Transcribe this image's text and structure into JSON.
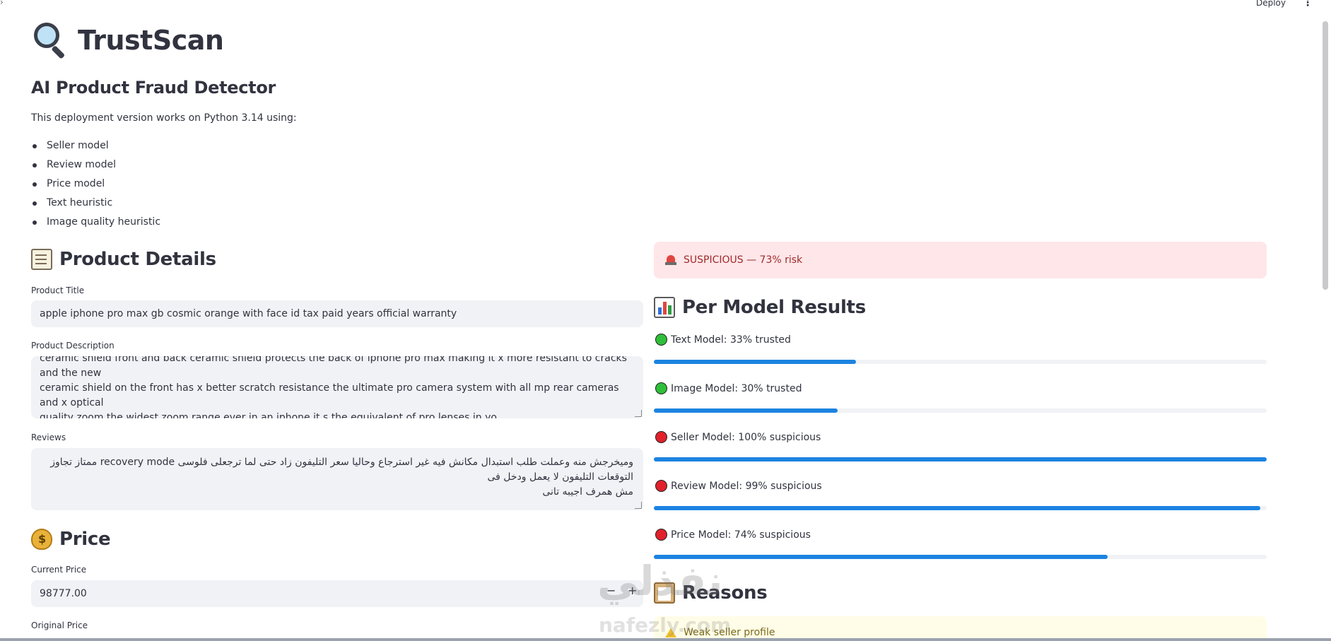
{
  "topbar": {
    "deploy_label": "Deploy",
    "menu_glyph": "⋮",
    "expand_glyph": "›"
  },
  "app": {
    "title": "TrustScan",
    "title_icon": "magnifying-glass-icon",
    "subtitle": "AI Product Fraud Detector",
    "intro": "This deployment version works on Python 3.14 using:",
    "components": [
      "Seller model",
      "Review model",
      "Price model",
      "Text heuristic",
      "Image quality heuristic"
    ]
  },
  "product": {
    "heading": "Product Details",
    "heading_icon": "memo-icon",
    "title_label": "Product Title",
    "title_value": "apple iphone pro max gb cosmic orange with face id tax paid years official warranty",
    "description_label": "Product Description",
    "description_lines": [
      "ceramic shield front and back ceramic shield protects the back of iphone pro max making it x more resistant to cracks and the new",
      "ceramic shield on the front has x better scratch resistance the ultimate pro camera system with all mp rear cameras and x optical",
      "quality zoom the widest zoom range ever in an iphone it s the equivalent of pro lenses in yo"
    ],
    "reviews_label": "Reviews",
    "reviews_line1": "وميخرجش منه وعملت طلب استبدال مكانش فيه غير استرجاع وحاليا سعر التليفون زاد حتى لما ترجعلى فلوسى recovery mode ممتاز تجاوز التوقعات التليفون لا يعمل ودخل فى",
    "reviews_line2": "مش همرف اجيبه تانى"
  },
  "price": {
    "heading": "Price",
    "heading_icon": "money-bag-icon",
    "current_label": "Current Price",
    "current_value": "98777.00",
    "minus": "−",
    "plus": "+",
    "original_label": "Original Price"
  },
  "verdict": {
    "icon": "police-light-icon",
    "text": "SUSPICIOUS — 73% risk",
    "color": "#9e2a2b",
    "background": "#ffe6e8"
  },
  "results": {
    "heading": "Per Model Results",
    "heading_icon": "bar-chart-icon",
    "bar_color": "#1c83e1",
    "models": [
      {
        "label": "Text Model: 33% trusted",
        "status": "green",
        "progress": 0.33
      },
      {
        "label": "Image Model: 30% trusted",
        "status": "green",
        "progress": 0.3
      },
      {
        "label": "Seller Model: 100% suspicious",
        "status": "red",
        "progress": 1.0
      },
      {
        "label": "Review Model: 99% suspicious",
        "status": "red",
        "progress": 0.99
      },
      {
        "label": "Price Model: 74% suspicious",
        "status": "red",
        "progress": 0.74
      }
    ]
  },
  "reasons": {
    "heading": "Reasons",
    "heading_icon": "clipboard-icon",
    "items": [
      {
        "icon": "warning-icon",
        "text": "Weak seller profile"
      }
    ]
  },
  "watermark": {
    "arabic": "نفذلي",
    "latin": "nafezly.com"
  }
}
